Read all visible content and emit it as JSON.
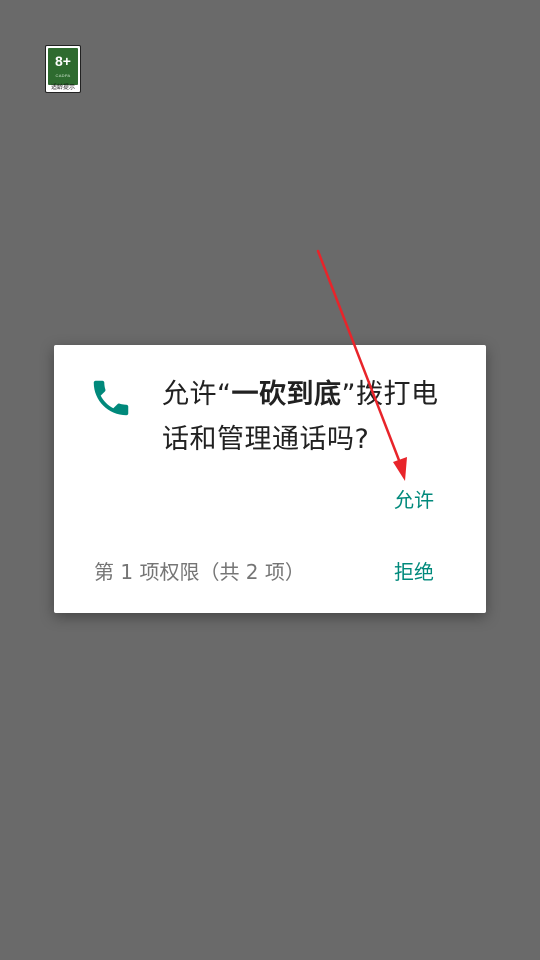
{
  "age_rating": {
    "label": "8+",
    "sub_label": "CADPA",
    "footer": "适龄提示"
  },
  "permission_dialog": {
    "icon": "phone-icon",
    "title_prefix": "允许“",
    "app_name": "一砍到底",
    "title_suffix_line1": "”拨打电",
    "title_line2": "话和管理通话吗?",
    "allow_label": "允许",
    "deny_label": "拒绝",
    "counter": "第 1 项权限（共 2 项）"
  },
  "colors": {
    "accent": "#00897b",
    "backdrop": "#6a6a6a",
    "annotation_arrow": "#e8242a"
  }
}
